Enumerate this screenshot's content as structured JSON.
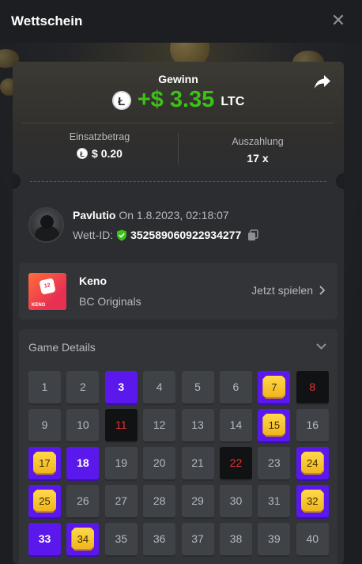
{
  "header": {
    "title": "Wettschein",
    "close_icon": "close-icon"
  },
  "win": {
    "label": "Gewinn",
    "amount": "+$ 3.35",
    "currency": "LTC",
    "coin_icon": "Ł",
    "share_icon": "share-icon"
  },
  "stats": {
    "bet_label": "Einsatzbetrag",
    "bet_value": "$ 0.20",
    "payout_label": "Auszahlung",
    "payout_value": "17 x"
  },
  "user": {
    "name": "Pavlutio",
    "date": "On 1.8.2023, 02:18:07",
    "bet_id_label": "Wett-ID:",
    "bet_id": "352589060922934277"
  },
  "game": {
    "name": "Keno",
    "provider": "BC Originals",
    "play_label": "Jetzt spielen",
    "thumb_number": "12",
    "thumb_text": "KENO"
  },
  "details": {
    "title": "Game Details",
    "cells": [
      {
        "n": "1",
        "s": "normal"
      },
      {
        "n": "2",
        "s": "normal"
      },
      {
        "n": "3",
        "s": "hit"
      },
      {
        "n": "4",
        "s": "normal"
      },
      {
        "n": "5",
        "s": "normal"
      },
      {
        "n": "6",
        "s": "normal"
      },
      {
        "n": "7",
        "s": "win"
      },
      {
        "n": "8",
        "s": "miss"
      },
      {
        "n": "9",
        "s": "normal"
      },
      {
        "n": "10",
        "s": "normal"
      },
      {
        "n": "11",
        "s": "miss"
      },
      {
        "n": "12",
        "s": "normal"
      },
      {
        "n": "13",
        "s": "normal"
      },
      {
        "n": "14",
        "s": "normal"
      },
      {
        "n": "15",
        "s": "win"
      },
      {
        "n": "16",
        "s": "normal"
      },
      {
        "n": "17",
        "s": "win"
      },
      {
        "n": "18",
        "s": "hit"
      },
      {
        "n": "19",
        "s": "normal"
      },
      {
        "n": "20",
        "s": "normal"
      },
      {
        "n": "21",
        "s": "normal"
      },
      {
        "n": "22",
        "s": "miss"
      },
      {
        "n": "23",
        "s": "normal"
      },
      {
        "n": "24",
        "s": "win"
      },
      {
        "n": "25",
        "s": "win"
      },
      {
        "n": "26",
        "s": "normal"
      },
      {
        "n": "27",
        "s": "normal"
      },
      {
        "n": "28",
        "s": "normal"
      },
      {
        "n": "29",
        "s": "normal"
      },
      {
        "n": "30",
        "s": "normal"
      },
      {
        "n": "31",
        "s": "normal"
      },
      {
        "n": "32",
        "s": "win"
      },
      {
        "n": "33",
        "s": "hit"
      },
      {
        "n": "34",
        "s": "win"
      },
      {
        "n": "35",
        "s": "normal"
      },
      {
        "n": "36",
        "s": "normal"
      },
      {
        "n": "37",
        "s": "normal"
      },
      {
        "n": "38",
        "s": "normal"
      },
      {
        "n": "39",
        "s": "normal"
      },
      {
        "n": "40",
        "s": "normal"
      }
    ]
  },
  "colors": {
    "win_green": "#3bc117",
    "hit_purple": "#5b18ec",
    "miss_red": "#e3342f",
    "gem_gold": "#ffd94a"
  }
}
